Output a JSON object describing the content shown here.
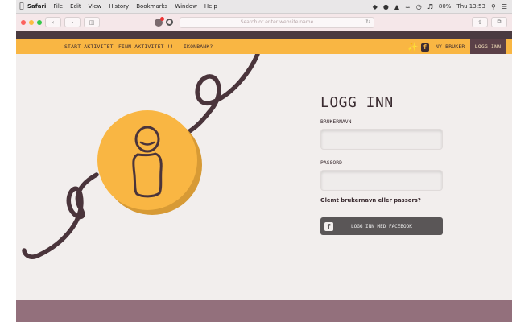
{
  "menubar": {
    "app": "Safari",
    "items": [
      "File",
      "Edit",
      "View",
      "History",
      "Bookmarks",
      "Window",
      "Help"
    ],
    "battery": "80%",
    "clock": "Thu 13:53"
  },
  "browser": {
    "url_placeholder": "Search or enter website name"
  },
  "nav": {
    "links": [
      "START AKTIVITET",
      "FINN AKTIVITET !!!",
      "IKONBANK?"
    ],
    "new_user": "NY BRUKER",
    "login": "LOGG INN"
  },
  "login": {
    "title": "LOGG INN",
    "username_label": "BRUKERNAVN",
    "password_label": "PASSORD",
    "forgot": "Glemt brukernavn eller passors?",
    "facebook_button": "LOGG INN MED FACEBOOK"
  },
  "colors": {
    "nav": "#f9b643",
    "footer": "#93707c",
    "rope": "#4a343b",
    "background": "#f2eeed"
  }
}
